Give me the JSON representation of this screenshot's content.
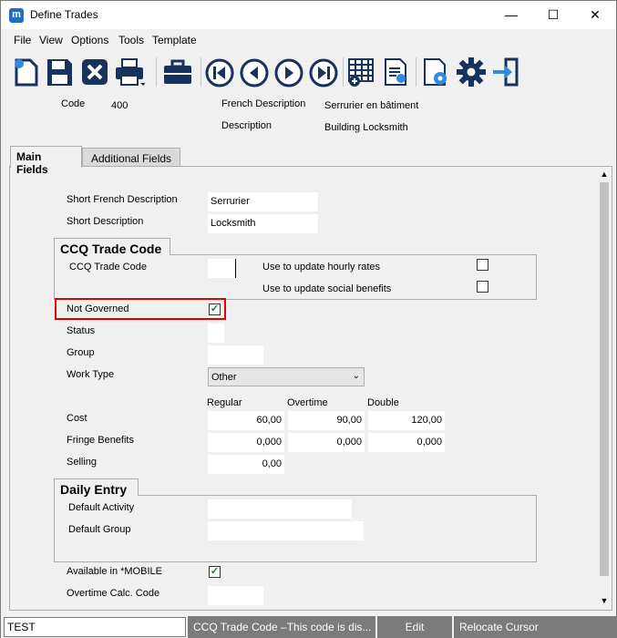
{
  "window": {
    "title": "Define Trades",
    "app_icon_letter": "m"
  },
  "menu": [
    "File",
    "View",
    "Options",
    "Tools",
    "Template"
  ],
  "header": {
    "code_label": "Code",
    "code_value": "400",
    "french_desc_label": "French Description",
    "french_desc_value": "Serrurier en bâtiment",
    "desc_label": "Description",
    "desc_value": "Building Locksmith"
  },
  "tabs": {
    "main": "Main Fields",
    "additional": "Additional Fields"
  },
  "fields": {
    "short_french_label": "Short French Description",
    "short_french_value": "Serrurier",
    "short_desc_label": "Short Description",
    "short_desc_value": "Locksmith"
  },
  "ccq": {
    "group_title": "CCQ Trade Code",
    "code_label": "CCQ Trade Code",
    "code_value": "",
    "hourly_label": "Use to update hourly rates",
    "hourly_checked": false,
    "social_label": "Use to update social benefits",
    "social_checked": false
  },
  "not_governed": {
    "label": "Not Governed",
    "checked": true
  },
  "status_label": "Status",
  "group_label": "Group",
  "work_type": {
    "label": "Work Type",
    "value": "Other"
  },
  "rates": {
    "col_regular": "Regular",
    "col_overtime": "Overtime",
    "col_double": "Double",
    "cost_label": "Cost",
    "cost_regular": "60,00",
    "cost_overtime": "90,00",
    "cost_double": "120,00",
    "fringe_label": "Fringe Benefits",
    "fringe_regular": "0,000",
    "fringe_overtime": "0,000",
    "fringe_double": "0,000",
    "selling_label": "Selling",
    "selling_regular": "0,00"
  },
  "daily_entry": {
    "group_title": "Daily Entry",
    "activity_label": "Default Activity",
    "group_label": "Default Group"
  },
  "mobile": {
    "label": "Available in *MOBILE",
    "checked": true
  },
  "overtime_calc_label": "Overtime Calc. Code",
  "status_bar": {
    "input_value": "TEST",
    "message": "CCQ Trade Code –This code is dis...",
    "mode": "Edit",
    "action": "Relocate Cursor"
  },
  "colors": {
    "highlight": "#e00000",
    "accent": "#1c6fc4",
    "icon_dark": "#17325c",
    "status_bg": "#7b7b7b"
  }
}
